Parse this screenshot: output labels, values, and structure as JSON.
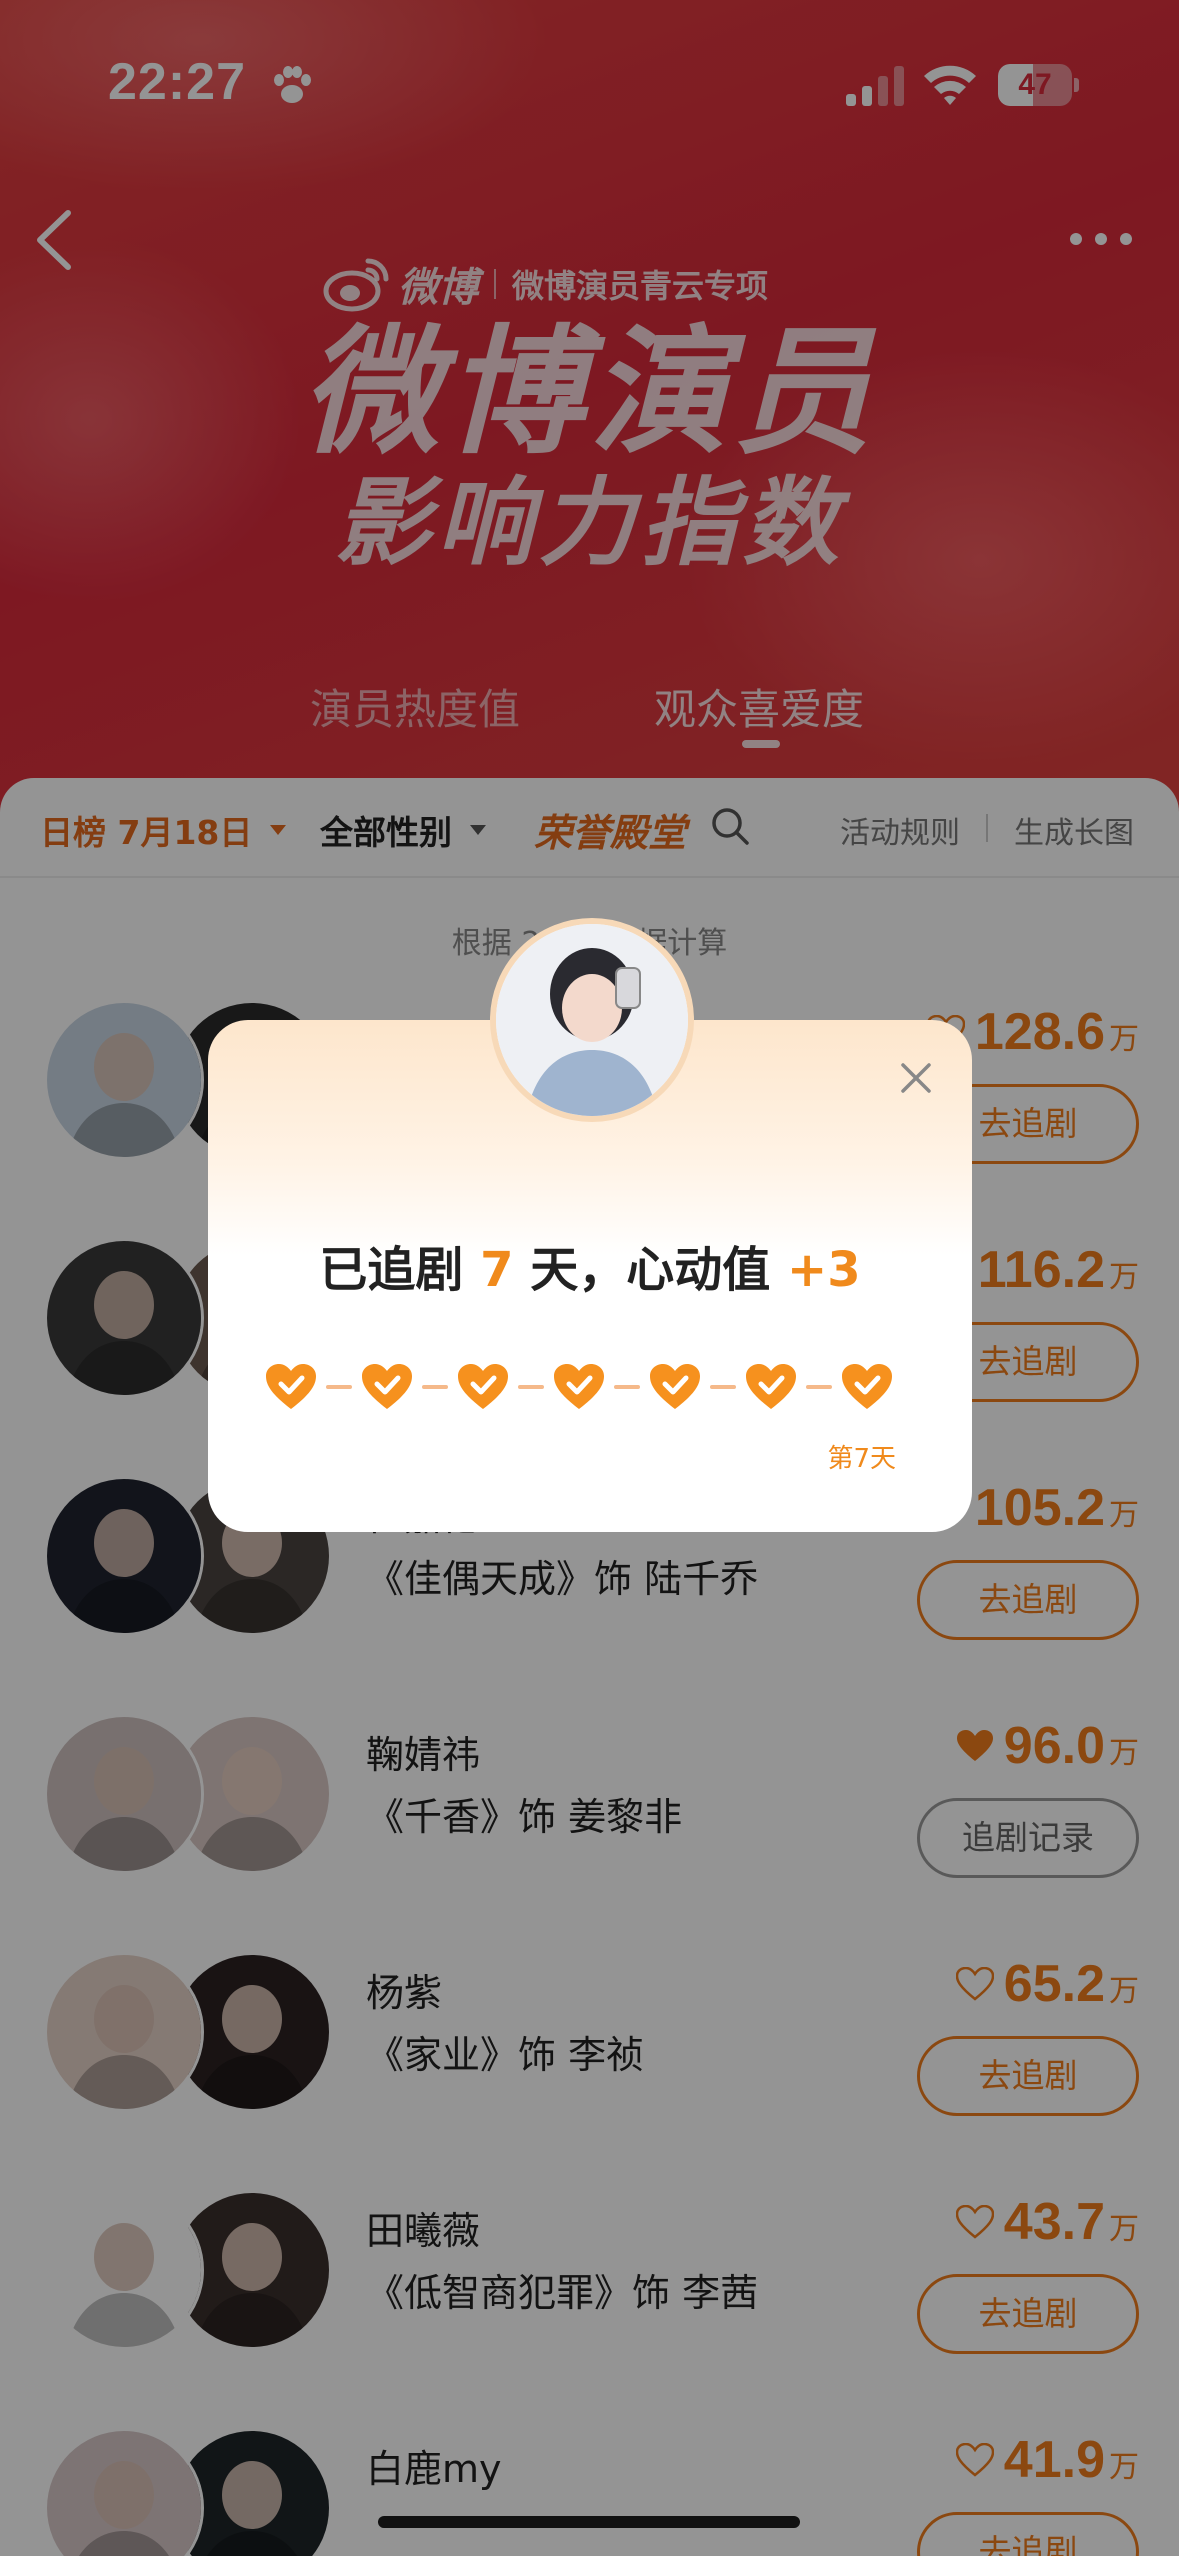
{
  "status_bar": {
    "time": "22:27",
    "battery": "47",
    "battery_level": 0.47,
    "icons": [
      "paw-icon",
      "signal-icon",
      "wifi-icon",
      "battery-icon"
    ]
  },
  "header": {
    "back_icon": "chevron-left-icon",
    "more_icon": "more-dots-icon",
    "brand": "微博",
    "brand_sub": "微博演员青云专项",
    "title_line1": "微博演员",
    "title_line2": "影响力指数"
  },
  "hero_tabs": [
    {
      "label": "演员热度值",
      "active": false
    },
    {
      "label": "观众喜爱度",
      "active": true
    }
  ],
  "filters": {
    "date": "日榜 7月18日",
    "gender": "全部性别",
    "honor": "荣誉殿堂",
    "rules": "活动规则",
    "long_image": "生成长图"
  },
  "note": "根据 2020 数据计算",
  "rankings": [
    {
      "name": "",
      "role": "",
      "score": "128.6",
      "unit": "万",
      "liked": false,
      "button": "去追剧",
      "avatar_colors": [
        "#c9d6e3",
        "#2a2a2a"
      ]
    },
    {
      "name": "",
      "role": "",
      "score": "116.2",
      "unit": "万",
      "liked": false,
      "button": "去追剧",
      "avatar_colors": [
        "#3a3a3a",
        "#6b5a50"
      ]
    },
    {
      "name": "任嘉伦Allen",
      "role": "《佳偶天成》饰 陆千乔",
      "score": "105.2",
      "unit": "万",
      "liked": false,
      "button": "去追剧",
      "avatar_colors": [
        "#1f2430",
        "#4a4440"
      ]
    },
    {
      "name": "鞠婧祎",
      "role": "《千香》饰 姜黎非",
      "score": "96.0",
      "unit": "万",
      "liked": true,
      "button": "追剧记录",
      "avatar_colors": [
        "#cfc2c0",
        "#d9c8c4"
      ]
    },
    {
      "name": "杨紫",
      "role": "《家业》饰 李祯",
      "score": "65.2",
      "unit": "万",
      "liked": false,
      "button": "去追剧",
      "avatar_colors": [
        "#e6d2c8",
        "#2b2222"
      ]
    },
    {
      "name": "田曦薇",
      "role": "《低智商犯罪》饰 李茜",
      "score": "43.7",
      "unit": "万",
      "liked": false,
      "button": "去追剧",
      "avatar_colors": [
        "#ffffff",
        "#3a2f2c"
      ]
    },
    {
      "name": "白鹿my",
      "role": "",
      "score": "41.9",
      "unit": "万",
      "liked": false,
      "button": "去追剧",
      "avatar_colors": [
        "#d8c8c8",
        "#1e2528"
      ]
    }
  ],
  "modal": {
    "prefix": "已追剧 ",
    "days": "7",
    "mid": " 天，心动值 ",
    "plus": "+3",
    "day_label": "第7天",
    "hearts_count": 7,
    "colors": {
      "accent": "#f08a1c",
      "heart": "#f6911e"
    }
  },
  "colors": {
    "brand_red": "#d92a3c",
    "orange": "#f07c1c"
  }
}
